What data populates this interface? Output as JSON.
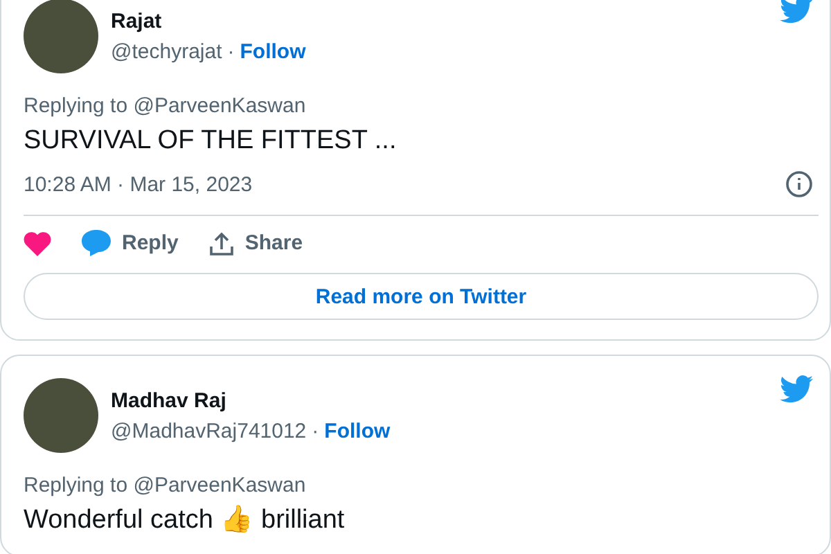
{
  "tweets": [
    {
      "name": "Rajat",
      "handle": "@techyrajat",
      "separator": "·",
      "follow": "Follow",
      "replying": "Replying to @ParveenKaswan",
      "text": "SURVIVAL OF THE FITTEST ...",
      "time": "10:28 AM · Mar 15, 2023",
      "actions": [
        {
          "kind": "like"
        },
        {
          "kind": "reply",
          "label": "Reply"
        },
        {
          "kind": "share",
          "label": "Share"
        }
      ],
      "read_more": "Read more on Twitter"
    },
    {
      "name": "Madhav Raj",
      "handle": "@MadhavRaj741012",
      "separator": "·",
      "follow": "Follow",
      "replying": "Replying to @ParveenKaswan",
      "text": "Wonderful catch 👍 brilliant"
    }
  ]
}
